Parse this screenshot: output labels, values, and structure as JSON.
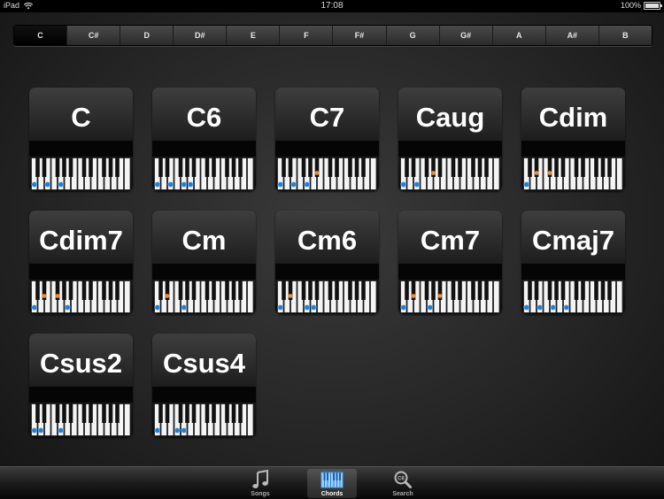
{
  "status_bar": {
    "device": "iPad",
    "time": "17:08",
    "battery": "100%"
  },
  "keys": [
    "C",
    "C#",
    "D",
    "D#",
    "E",
    "F",
    "F#",
    "G",
    "G#",
    "A",
    "A#",
    "B"
  ],
  "selected_key": "C",
  "chords": [
    {
      "name": "C",
      "notes": [
        0,
        4,
        7
      ]
    },
    {
      "name": "C6",
      "notes": [
        0,
        4,
        7,
        9
      ]
    },
    {
      "name": "C7",
      "notes": [
        0,
        4,
        7,
        10
      ]
    },
    {
      "name": "Caug",
      "notes": [
        0,
        4,
        8
      ]
    },
    {
      "name": "Cdim",
      "notes": [
        0,
        3,
        6
      ]
    },
    {
      "name": "Cdim7",
      "notes": [
        0,
        3,
        6,
        9
      ]
    },
    {
      "name": "Cm",
      "notes": [
        0,
        3,
        7
      ]
    },
    {
      "name": "Cm6",
      "notes": [
        0,
        3,
        7,
        9
      ]
    },
    {
      "name": "Cm7",
      "notes": [
        0,
        3,
        7,
        10
      ]
    },
    {
      "name": "Cmaj7",
      "notes": [
        0,
        4,
        7,
        11
      ]
    },
    {
      "name": "Csus2",
      "notes": [
        0,
        2,
        7
      ]
    },
    {
      "name": "Csus4",
      "notes": [
        0,
        5,
        7
      ]
    }
  ],
  "tabs": [
    {
      "label": "Songs",
      "icon": "music-note-icon",
      "active": false
    },
    {
      "label": "Chords",
      "icon": "piano-icon",
      "active": true
    },
    {
      "label": "Search",
      "icon": "search-icon",
      "active": false
    }
  ],
  "colors": {
    "white_key_marker": "#1f7fd6",
    "black_key_marker": "#f08a2a"
  }
}
